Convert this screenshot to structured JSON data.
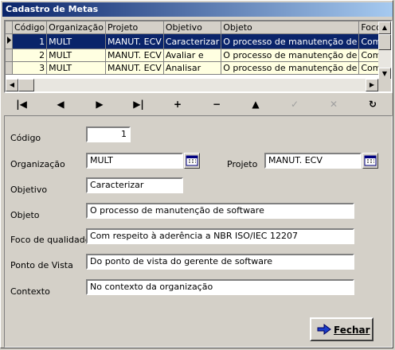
{
  "window": {
    "title": "Cadastro de Metas"
  },
  "grid": {
    "columns": [
      "Código",
      "Organização",
      "Projeto",
      "Objetivo",
      "Objeto",
      "Foco de"
    ],
    "rows": [
      [
        "1",
        "MULT",
        "MANUT. ECV",
        "Caracterizar",
        "O processo de manutenção de",
        "Com respe"
      ],
      [
        "2",
        "MULT",
        "MANUT. ECV",
        "Avaliar e",
        "O processo de manutenção de",
        "Com respe"
      ],
      [
        "3",
        "MULT",
        "MANUT. ECV",
        "Analisar",
        "O processo de manutenção de",
        "Com respe"
      ]
    ]
  },
  "navigator": {
    "first": "|◀",
    "prior": "◀",
    "next": "▶",
    "last": "▶|",
    "insert": "+",
    "delete": "−",
    "edit": "▲",
    "post": "✓",
    "cancel": "✕",
    "refresh": "↻"
  },
  "form": {
    "codigo_label": "Código",
    "codigo_value": "1",
    "organizacao_label": "Organização",
    "organizacao_value": "MULT",
    "projeto_label": "Projeto",
    "projeto_value": "MANUT. ECV",
    "objetivo_label": "Objetivo",
    "objetivo_value": "Caracterizar",
    "objeto_label": "Objeto",
    "objeto_value": "O processo de manutenção de software",
    "foco_label": "Foco de qualidade",
    "foco_value": "Com respeito à aderência a NBR ISO/IEC 12207",
    "ponto_label": "Ponto de Vista",
    "ponto_value": "Do ponto de vista do gerente de software",
    "contexto_label": "Contexto",
    "contexto_value": " No contexto da organização"
  },
  "footer": {
    "close_label": "Fechar"
  }
}
